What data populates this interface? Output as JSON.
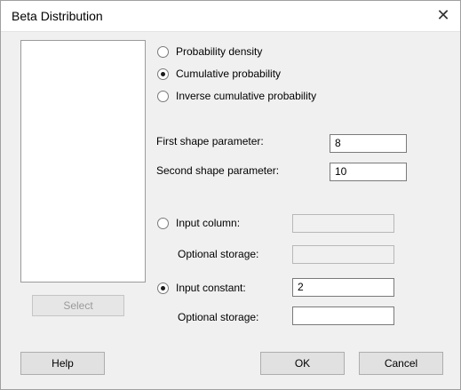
{
  "window": {
    "title": "Beta Distribution",
    "close_glyph": "✕"
  },
  "select_button": "Select",
  "mode_options": [
    {
      "label": "Probability density",
      "checked": false
    },
    {
      "label": "Cumulative probability",
      "checked": true
    },
    {
      "label": "Inverse cumulative probability",
      "checked": false
    }
  ],
  "parameters": {
    "first_label": "First shape parameter:",
    "first_value": "8",
    "second_label": "Second shape parameter:",
    "second_value": "10"
  },
  "input_column": {
    "label": "Input column:",
    "checked": false,
    "value": "",
    "storage_label": "Optional storage:",
    "storage_value": ""
  },
  "input_constant": {
    "label": "Input constant:",
    "checked": true,
    "value": "2",
    "storage_label": "Optional storage:",
    "storage_value": ""
  },
  "buttons": {
    "help": "Help",
    "ok": "OK",
    "cancel": "Cancel"
  }
}
